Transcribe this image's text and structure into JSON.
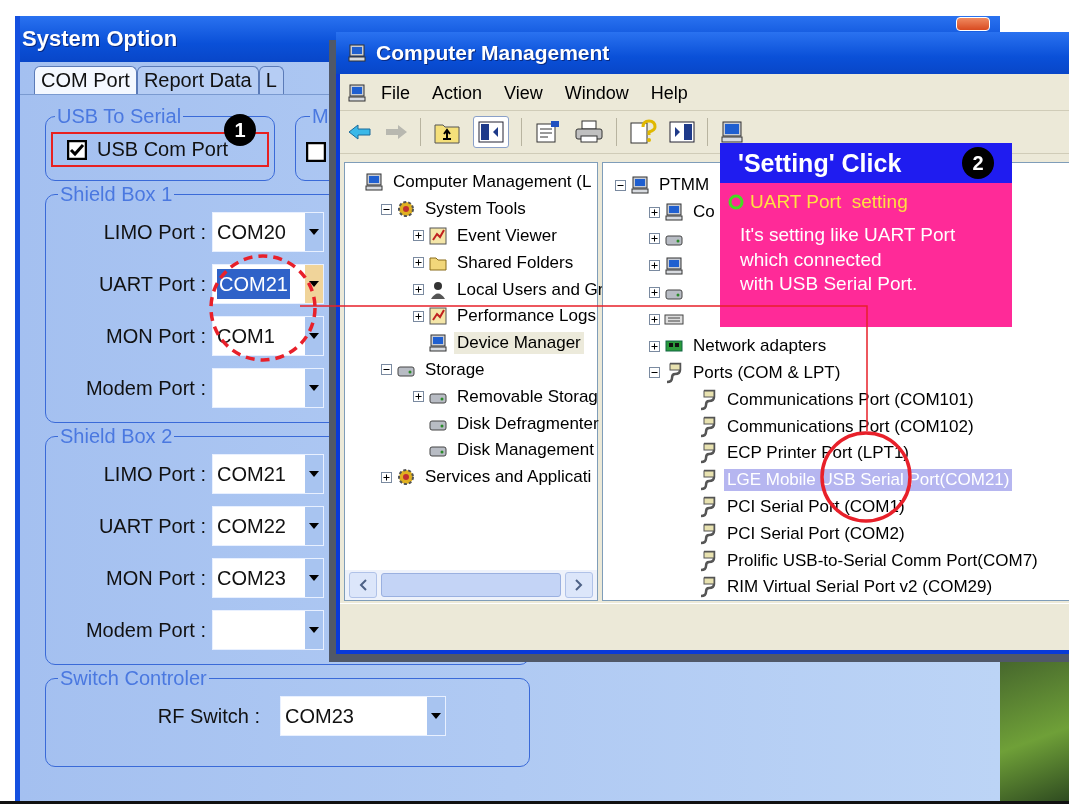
{
  "system_option": {
    "title": "System Option",
    "tabs": [
      {
        "label": "COM Port",
        "selected": true
      },
      {
        "label": "Report Data",
        "selected": false
      },
      {
        "label": "L",
        "selected": false
      }
    ],
    "usb_to_serial": {
      "legend": "USB To Serial",
      "checkbox": {
        "label": "USB Com Port",
        "checked": true
      },
      "step": "1"
    },
    "group_2": {
      "legend": "M",
      "checkbox": {
        "checked": false
      }
    },
    "shield_boxes": [
      {
        "legend": "Shield Box 1",
        "ports": [
          {
            "label": "LIMO Port :",
            "value": "COM20",
            "selected": false
          },
          {
            "label": "UART Port :",
            "value": "COM21",
            "selected": true
          },
          {
            "label": "MON Port :",
            "value": "COM1",
            "selected": false
          },
          {
            "label": "Modem Port :",
            "selected": false
          }
        ]
      },
      {
        "legend": "Shield Box 2",
        "ports": [
          {
            "label": "LIMO Port :",
            "value": "COM21",
            "selected": false
          },
          {
            "label": "UART Port :",
            "value": "COM22",
            "selected": false
          },
          {
            "label": "MON Port :",
            "value": "COM23",
            "selected": false
          },
          {
            "label": "Modem Port :",
            "selected": false
          }
        ]
      }
    ],
    "switch_controller": {
      "legend": "Switch Controler",
      "ports": [
        {
          "label": "RF Switch :",
          "value": "COM23",
          "selected": false
        }
      ]
    }
  },
  "computer_management": {
    "title": "Computer Management",
    "menu": [
      "File",
      "Action",
      "View",
      "Window",
      "Help"
    ],
    "left_tree": [
      {
        "label": "Computer Management (L",
        "kind": "computer",
        "selected": false,
        "children": [
          {
            "label": "System Tools",
            "kind": "gear",
            "expanded": true,
            "selected": false,
            "children": [
              {
                "label": "Event Viewer",
                "kind": "chart",
                "expanded": false,
                "selected": false
              },
              {
                "label": "Shared Folders",
                "kind": "folder",
                "expanded": false,
                "selected": false
              },
              {
                "label": "Local Users and Gr",
                "kind": "user",
                "expanded": false,
                "selected": false
              },
              {
                "label": "Performance Logs",
                "kind": "chart",
                "expanded": false,
                "selected": false
              },
              {
                "label": "Device Manager",
                "kind": "computer",
                "selected": true
              }
            ]
          },
          {
            "label": "Storage",
            "kind": "disk",
            "expanded": true,
            "selected": false,
            "children": [
              {
                "label": "Removable Storag",
                "kind": "disk",
                "expanded": false,
                "selected": false
              },
              {
                "label": "Disk Defragmenter",
                "kind": "disk",
                "selected": false
              },
              {
                "label": "Disk Management",
                "kind": "disk",
                "selected": false
              }
            ]
          },
          {
            "label": "Services and Applicati",
            "kind": "gear",
            "expanded": false,
            "selected": false
          }
        ]
      }
    ],
    "right_tree": [
      {
        "label": "PTMM",
        "kind": "computer",
        "expanded": true,
        "selected": false,
        "children": [
          {
            "label": "Co",
            "kind": "computer",
            "expanded": false,
            "selected": false
          },
          {
            "kind": "disk",
            "expanded": false
          },
          {
            "kind": "computer",
            "expanded": false
          },
          {
            "kind": "disk",
            "expanded": false
          },
          {
            "kind": "keyboard",
            "expanded": false
          },
          {
            "label": "Network adapters",
            "kind": "chip",
            "expanded": false,
            "selected": false
          },
          {
            "label": "Ports (COM & LPT)",
            "kind": "plug",
            "expanded": true,
            "selected": false,
            "children": [
              {
                "label": "Communications Port (COM101)",
                "kind": "plug",
                "selected": false
              },
              {
                "label": "Communications Port (COM102)",
                "kind": "plug",
                "selected": false
              },
              {
                "label": "ECP Printer Port (LPT1)",
                "kind": "plug",
                "selected": false
              },
              {
                "label": "LGE Mobile USB Serial Port(COM21)",
                "kind": "plug",
                "selected": true
              },
              {
                "label": "PCI Serial Port (COM1)",
                "kind": "plug",
                "selected": false
              },
              {
                "label": "PCI Serial Port (COM2)",
                "kind": "plug",
                "selected": false
              },
              {
                "label": "Prolific USB-to-Serial Comm Port(COM7)",
                "kind": "plug",
                "selected": false
              },
              {
                "label": "RIM Virtual Serial Port v2 (COM29)",
                "kind": "plug",
                "selected": false
              }
            ]
          }
        ]
      }
    ]
  },
  "callout": {
    "title": "'Setting' Click",
    "step": "2",
    "heading": "UART Port  setting",
    "lines": [
      "It's setting like UART Port",
      "which connected",
      "with USB Serial Port."
    ]
  }
}
